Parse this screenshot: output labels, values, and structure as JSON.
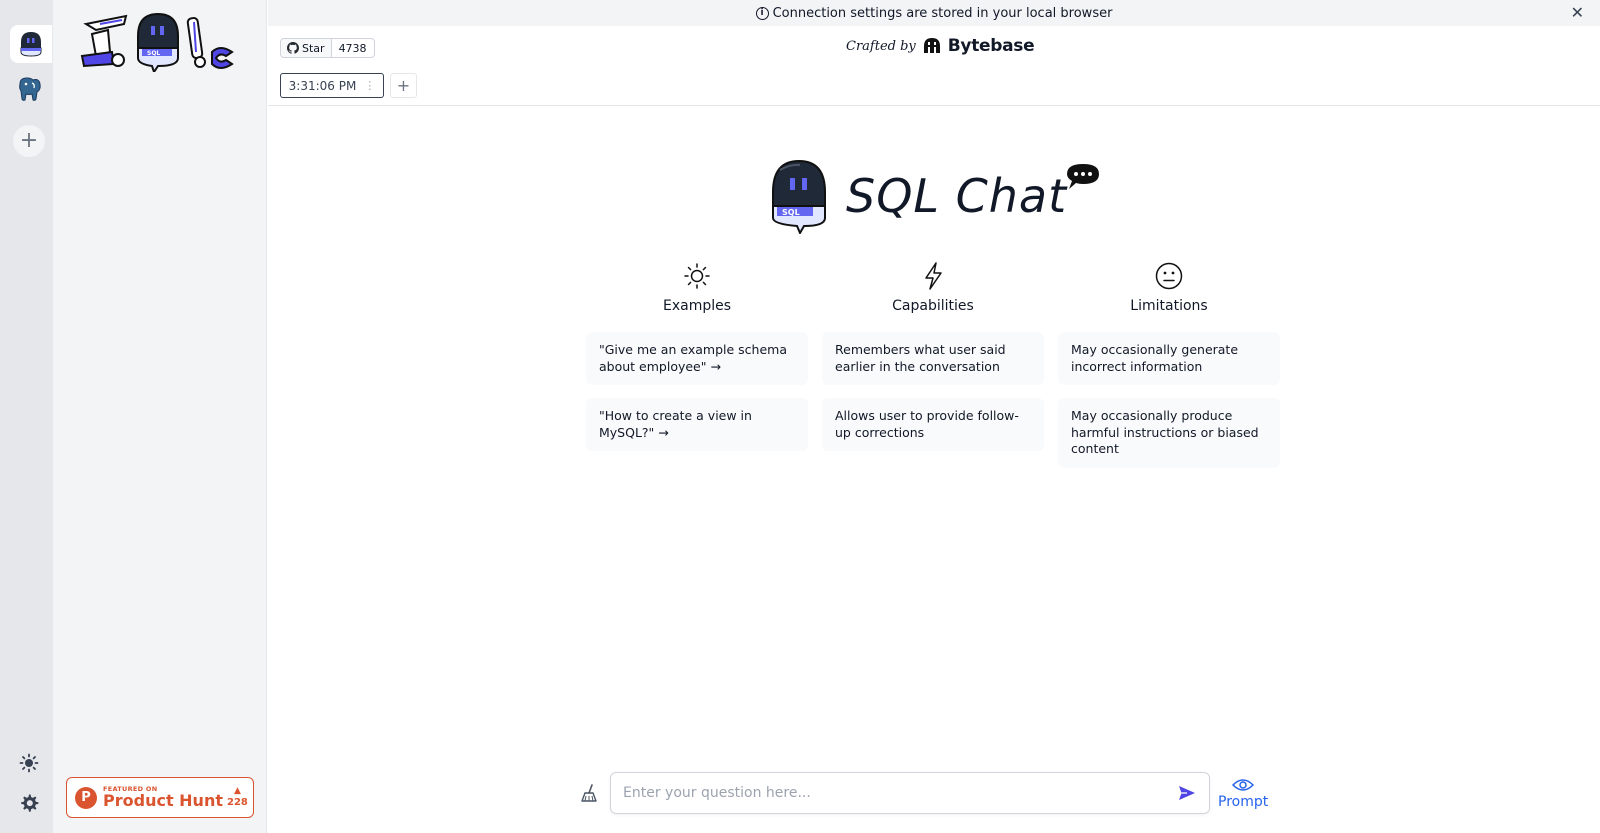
{
  "banner": {
    "text": "Connection settings are stored in your local browser"
  },
  "github": {
    "star_label": "Star",
    "star_count": "4738"
  },
  "header": {
    "crafted_by": "Crafted by",
    "brand": "Bytebase"
  },
  "tabs": [
    {
      "label": "3:31:06 PM"
    }
  ],
  "hero": {
    "title": "SQL Chat"
  },
  "columns": [
    {
      "icon": "sun-icon",
      "title": "Examples",
      "items": [
        "\"Give me an example schema about employee\" →",
        "\"How to create a view in MySQL?\" →"
      ]
    },
    {
      "icon": "lightning-icon",
      "title": "Capabilities",
      "items": [
        "Remembers what user said earlier in the conversation",
        "Allows user to provide follow-up corrections"
      ]
    },
    {
      "icon": "neutral-face-icon",
      "title": "Limitations",
      "items": [
        "May occasionally generate incorrect information",
        "May occasionally produce harmful instructions or biased content"
      ]
    }
  ],
  "input": {
    "placeholder": "Enter your question here...",
    "value": ""
  },
  "prompt_button": {
    "label": "Prompt"
  },
  "product_hunt": {
    "small": "FEATURED ON",
    "big": "Product Hunt",
    "count": "228"
  },
  "colors": {
    "accent": "#4f46e5",
    "product_hunt": "#da552f",
    "link": "#2563eb"
  }
}
